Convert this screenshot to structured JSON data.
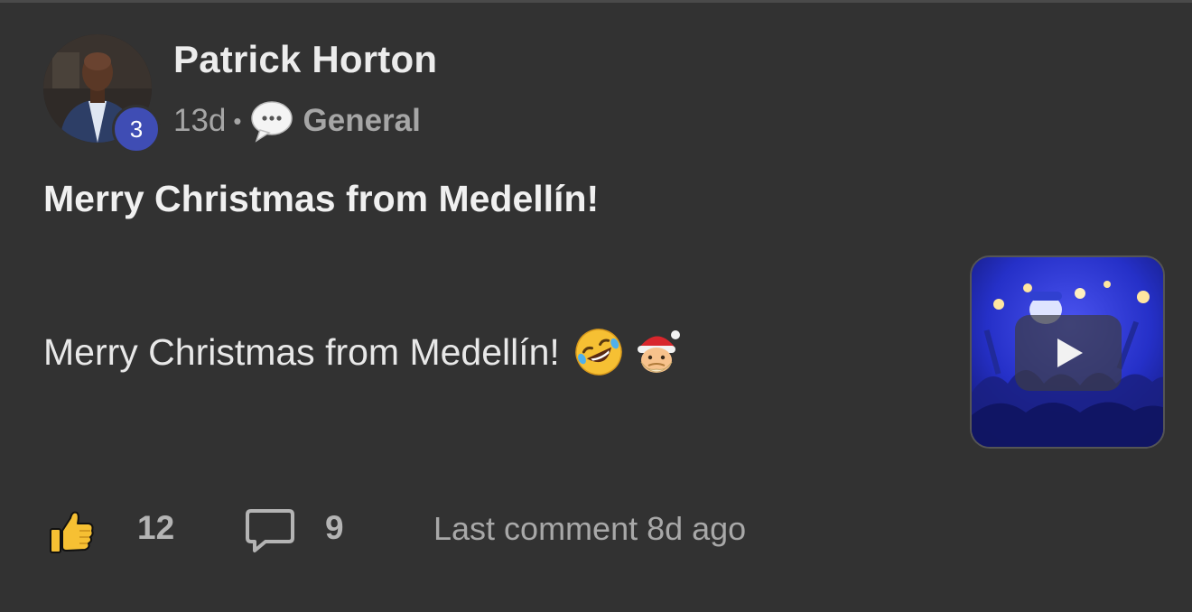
{
  "author": {
    "name": "Patrick Horton",
    "level": "3"
  },
  "meta": {
    "time_ago": "13d",
    "separator": "•",
    "category_icon": "speech-bubble-icon",
    "category": "General"
  },
  "post": {
    "title": "Merry Christmas from Medellín!",
    "body": "Merry Christmas from Medellín!",
    "emojis": [
      "rolling-on-floor-laughing-emoji",
      "santa-claus-emoji"
    ]
  },
  "attachment": {
    "type": "video",
    "icon": "play-icon"
  },
  "footer": {
    "like_icon": "thumbs-up-icon",
    "like_count": "12",
    "comment_icon": "comment-bubble-icon",
    "comment_count": "9",
    "last_comment": "Last comment 8d ago"
  },
  "colors": {
    "background": "#323232",
    "badge": "#3f4db4",
    "video_blue": "#1a1f8a"
  }
}
